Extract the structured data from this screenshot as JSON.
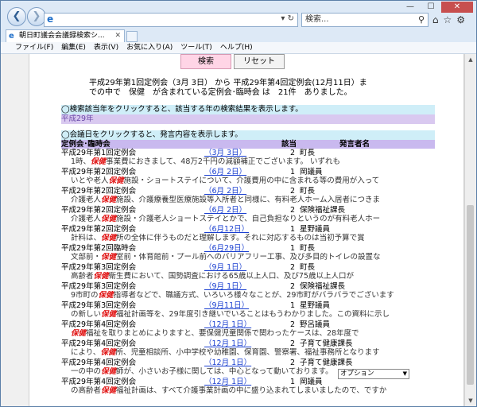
{
  "browser": {
    "address": "",
    "search_placeholder": "検索...",
    "tab_title": "朝日町議会会議録検索シ...",
    "window_controls": [
      "—",
      "☐",
      "✕"
    ],
    "tools_icons": "⌂☆⚙"
  },
  "menu": [
    "ファイル(F)",
    "編集(E)",
    "表示(V)",
    "お気に入り(A)",
    "ツール(T)",
    "ヘルプ(H)"
  ],
  "buttons": {
    "search": "検索",
    "reset": "リセット"
  },
  "summary": {
    "line1": "平成29年第1回定例会（3月 3日） から 平成29年第4回定例会(12月11日）ま",
    "line2": "での中で　保健　が含まれている定例会･臨時会 は　21件　ありました。"
  },
  "hints": {
    "year": "◯検索該当年をクリックすると、該当する年の検索結果を表示します。",
    "meeting": "◯会議日をクリックすると、発言内容を表示します。"
  },
  "year_link": "平成29年",
  "columns": {
    "meeting": "定例会･臨時会",
    "count": "該当",
    "speaker": "発言者名"
  },
  "results": [
    {
      "meeting": "平成29年第1回定例会",
      "date": "（3月 3日）",
      "count": "2",
      "speaker": "町長",
      "pre": "1時、",
      "kw": "保健",
      "post": "事業費におきまして、48万2千円の減額補正でございます。 いずれも"
    },
    {
      "meeting": "平成29年第2回定例会",
      "date": "（6月 2日）",
      "count": "1",
      "speaker": "岡議員",
      "pre": "いとや老人",
      "kw": "保健",
      "post": "施設・ショートステイについて、介護費用の中に含まれる等の費用が入って"
    },
    {
      "meeting": "平成29年第2回定例会",
      "date": "（6月 2日）",
      "count": "2",
      "speaker": "町長",
      "pre": "介護老人",
      "kw": "保健",
      "post": "施設、介護療養型医療施設等入所者と同様に、有料老人ホーム入居者につきま"
    },
    {
      "meeting": "平成29年第2回定例会",
      "date": "（6月 2日）",
      "count": "2",
      "speaker": "保険福祉課長",
      "pre": "介護老人",
      "kw": "保健",
      "post": "施設・介護老人ショートステイとかで、自己負担なりというのが有料老人ホー"
    },
    {
      "meeting": "平成29年第2回定例会",
      "date": "（6月12日）",
      "count": "1",
      "speaker": "星野議員",
      "pre": "計料は、",
      "kw": "保健",
      "post": "所の全体に伴うものだと理解します。それに対応するものは当初予算で賞"
    },
    {
      "meeting": "平成29年第2回臨時会",
      "date": "（6月29日）",
      "count": "1",
      "speaker": "町長",
      "pre": "文部前・",
      "kw": "保健",
      "post": "室前・体育館前・プール前へのバリアフリー工事、及び多目的トイレの設置な"
    },
    {
      "meeting": "平成29年第3回定例会",
      "date": "（9月 1日）",
      "count": "2",
      "speaker": "町長",
      "pre": "高齢者",
      "kw": "保健",
      "post": "衛生費において、国勢調査における65歳以上人口、及び75歳以上人口が"
    },
    {
      "meeting": "平成29年第3回定例会",
      "date": "（9月 1日）",
      "count": "2",
      "speaker": "保険福祉課長",
      "pre": "9市町の",
      "kw": "保健",
      "post": "指導者などで、職議方式、いろいろ様々なことが、29市町がバラバラでございます"
    },
    {
      "meeting": "平成29年第3回定例会",
      "date": "（9月11日）",
      "count": "1",
      "speaker": "星野議員",
      "pre": "の新しい",
      "kw": "保健",
      "post": "福祉計画等を、29年度引き継いでいることはもうわかりました。この資料に示し"
    },
    {
      "meeting": "平成29年第4回定例会",
      "date": "（12月 1日）",
      "count": "2",
      "speaker": "野呂議員",
      "pre": "",
      "kw": "保健",
      "post": "福祉を取りまとめによりますと、要保健児童関係で関わったケースは、28年度で"
    },
    {
      "meeting": "平成29年第4回定例会",
      "date": "（12月 1日）",
      "count": "2",
      "speaker": "子育て健康課長",
      "pre": "により、",
      "kw": "保健",
      "post": "所、児童相談所、小中学校や幼稚園、保育園、警察署、福祉事務所となります"
    },
    {
      "meeting": "平成29年第4回定例会",
      "date": "（12月 1日）",
      "count": "2",
      "speaker": "子育て健康課長",
      "pre": "一の中の",
      "kw": "保健",
      "post": "師が、小さいお子様に関しては、中心となって動いております。"
    },
    {
      "meeting": "平成29年第4回定例会",
      "date": "（12月 1日）",
      "count": "1",
      "speaker": "岡議員",
      "pre": "の高齢者",
      "kw": "保健",
      "post": "福祉計画は、すべて介護事業計画の中に盛り込まれてしまいましたので、ですか"
    }
  ],
  "option_select": "オプション"
}
